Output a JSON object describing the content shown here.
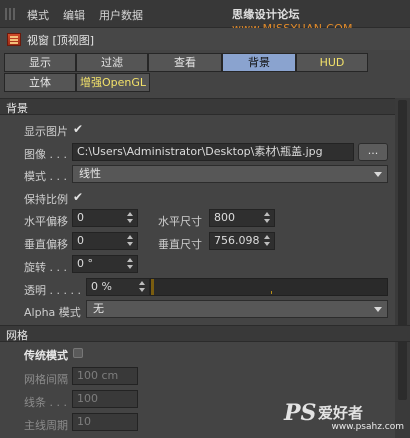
{
  "menubar": {
    "items": [
      "模式",
      "编辑",
      "用户数据"
    ],
    "watermark_prefix": "思缘设计论坛 ",
    "watermark_url": "www.MISSYUAN.COM"
  },
  "window": {
    "title": "视窗 [顶视图]"
  },
  "tabs": {
    "row1": [
      "显示",
      "过滤",
      "查看",
      "背景",
      "HUD"
    ],
    "row2": [
      "立体",
      "增强OpenGL"
    ],
    "active": "背景"
  },
  "sections": {
    "background": "背景",
    "grid": "网格"
  },
  "background": {
    "show_image_label": "显示图片",
    "show_image_checked": "✔",
    "image_label": "图像 . . .",
    "image_path": "C:\\Users\\Administrator\\Desktop\\素材\\瓶盖.jpg",
    "browse_label": "...",
    "mode_label": "模式 . . .",
    "mode_value": "线性",
    "keep_ratio_label": "保持比例",
    "keep_ratio_checked": "✔",
    "h_offset_label": "水平偏移",
    "h_offset_value": "0",
    "h_size_label": "水平尺寸",
    "h_size_value": "800",
    "v_offset_label": "垂直偏移",
    "v_offset_value": "0",
    "v_size_label": "垂直尺寸",
    "v_size_value": "756.098",
    "rotate_label": "旋转 . . .",
    "rotate_value": "0 °",
    "transparency_label": "透明 . . . . .",
    "transparency_value": "0 %",
    "alpha_mode_label": "Alpha 模式",
    "alpha_mode_value": "无"
  },
  "grid": {
    "legacy_label": "传统模式",
    "spacing_label": "网格间隔",
    "spacing_value": "100 cm",
    "lines_label": "线条 . . .",
    "lines_value": "100",
    "major_label": "主线周期",
    "major_value": "10"
  },
  "logo": {
    "ps": "PS",
    "cn": "爱好者",
    "url": "www.psahz.com"
  }
}
